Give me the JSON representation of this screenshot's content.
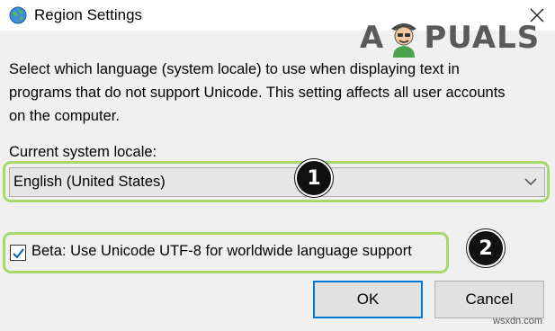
{
  "window": {
    "title": "Region Settings"
  },
  "watermark": {
    "brand": "APPUALS",
    "left_letter": "A",
    "right_letters": "PUALS"
  },
  "description": "Select which language (system locale) to use when displaying text in programs that do not support Unicode. This setting affects all user accounts on the computer.",
  "locale": {
    "label": "Current system locale:",
    "selected": "English (United States)"
  },
  "beta": {
    "label": "Beta: Use Unicode UTF-8 for worldwide language support",
    "checked": true
  },
  "buttons": {
    "ok": "OK",
    "cancel": "Cancel"
  },
  "annotations": {
    "step1": "1",
    "step2": "2",
    "highlight_color": "#a6d96a"
  },
  "site": "wsxdn.com",
  "icons": {
    "app": "globe-icon",
    "close": "close-icon",
    "dropdown": "chevron-down-icon",
    "check": "checkmark-icon"
  },
  "colors": {
    "titlebar": "#ffffff",
    "dialog": "#f0f0f0",
    "focus": "#0078d7",
    "checkbox_check": "#0063b1"
  }
}
